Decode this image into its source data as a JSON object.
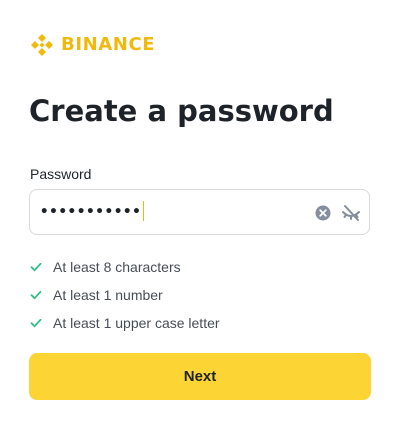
{
  "brand": {
    "name": "BINANCE",
    "logo_icon": "binance-diamond-icon",
    "color": "#f0b90b"
  },
  "page": {
    "title": "Create a password"
  },
  "password_field": {
    "label": "Password",
    "value": "•••••••••••",
    "clear_icon": "clear-circle-x-icon",
    "visibility_icon": "eye-slash-icon"
  },
  "requirements": [
    {
      "text": "At least 8 characters",
      "met": true,
      "icon": "check-icon"
    },
    {
      "text": "At least 1 number",
      "met": true,
      "icon": "check-icon"
    },
    {
      "text": "At least 1 upper case letter",
      "met": true,
      "icon": "check-icon"
    }
  ],
  "actions": {
    "next_label": "Next"
  },
  "colors": {
    "accent": "#fcd535",
    "check": "#2ebd85",
    "text_primary": "#1e2329",
    "text_secondary": "#474d57"
  }
}
